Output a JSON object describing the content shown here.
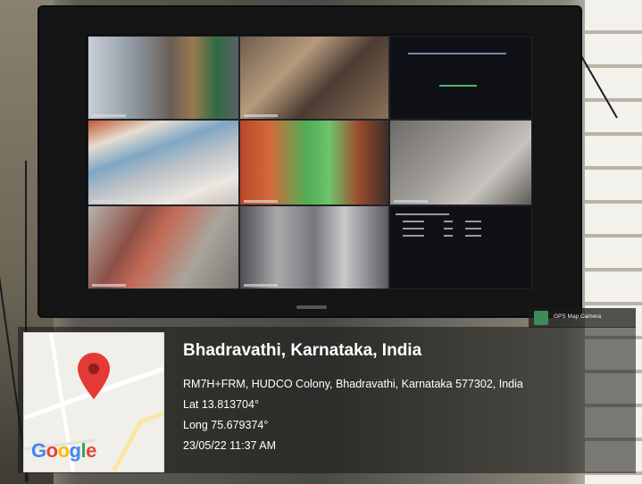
{
  "location": {
    "title": "Bhadravathi, Karnataka, India",
    "address": "RM7H+FRM, HUDCO Colony, Bhadravathi, Karnataka 577302, India",
    "lat": "Lat 13.813704°",
    "long": "Long 75.679374°",
    "datetime": "23/05/22 11:37 AM"
  },
  "badge": {
    "label": "GPS Map Camera",
    "icon": "gps-map-camera-icon"
  },
  "map": {
    "logo": "Google",
    "pin_icon": "map-pin-icon",
    "pin_color": "#e53935"
  },
  "cctv": {
    "grid": "3x3",
    "cameras": [
      "camera-1",
      "camera-2",
      "camera-3",
      "camera-4",
      "camera-5",
      "camera-6",
      "camera-7",
      "camera-8",
      "camera-9"
    ]
  }
}
